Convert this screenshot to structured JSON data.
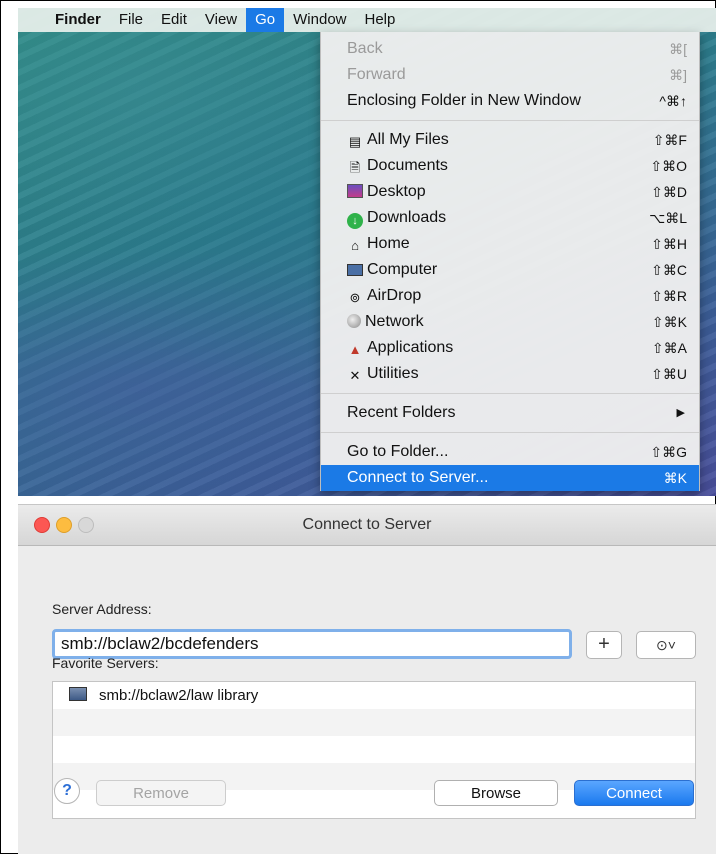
{
  "menubar": {
    "apple_icon": "apple-logo-icon",
    "items": [
      "Finder",
      "File",
      "Edit",
      "View",
      "Go",
      "Window",
      "Help"
    ]
  },
  "go_menu": {
    "group1": [
      {
        "label": "Back",
        "shortcut": "⌘[",
        "disabled": true
      },
      {
        "label": "Forward",
        "shortcut": "⌘]",
        "disabled": true
      },
      {
        "label": "Enclosing Folder in New Window",
        "shortcut": "^⌘↑",
        "disabled": false
      }
    ],
    "group2": [
      {
        "label": "All My Files",
        "shortcut": "⇧⌘F",
        "icon": "all-my-files-icon"
      },
      {
        "label": "Documents",
        "shortcut": "⇧⌘O",
        "icon": "documents-icon"
      },
      {
        "label": "Desktop",
        "shortcut": "⇧⌘D",
        "icon": "desktop-icon"
      },
      {
        "label": "Downloads",
        "shortcut": "⌥⌘L",
        "icon": "downloads-icon"
      },
      {
        "label": "Home",
        "shortcut": "⇧⌘H",
        "icon": "home-icon"
      },
      {
        "label": "Computer",
        "shortcut": "⇧⌘C",
        "icon": "computer-icon"
      },
      {
        "label": "AirDrop",
        "shortcut": "⇧⌘R",
        "icon": "airdrop-icon"
      },
      {
        "label": "Network",
        "shortcut": "⇧⌘K",
        "icon": "network-icon"
      },
      {
        "label": "Applications",
        "shortcut": "⇧⌘A",
        "icon": "applications-icon"
      },
      {
        "label": "Utilities",
        "shortcut": "⇧⌘U",
        "icon": "utilities-icon"
      }
    ],
    "recent_folders": {
      "label": "Recent Folders"
    },
    "go_to_folder": {
      "label": "Go to Folder...",
      "shortcut": "⇧⌘G"
    },
    "connect_to_server": {
      "label": "Connect to Server...",
      "shortcut": "⌘K",
      "highlighted": true
    }
  },
  "dialog": {
    "title": "Connect to Server",
    "server_address_label": "Server Address:",
    "server_address_value": "smb://bclaw2/bcdefenders",
    "add_button": "+",
    "recent_button": "⊙˅",
    "favorites_label": "Favorite Servers:",
    "favorites": [
      "smb://bclaw2/law library"
    ],
    "help_button": "?",
    "remove_button": "Remove",
    "browse_button": "Browse",
    "connect_button": "Connect"
  },
  "colors": {
    "accent": "#1b7ae6",
    "connect_button": "#1a79ee",
    "traffic_red": "#fc5753",
    "traffic_yellow": "#fdbc40"
  }
}
